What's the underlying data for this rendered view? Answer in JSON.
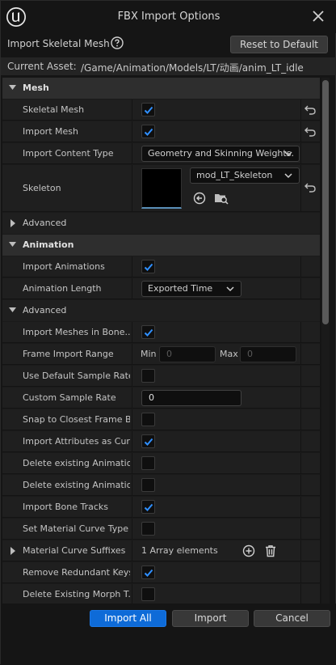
{
  "window": {
    "title": "FBX Import Options"
  },
  "header": {
    "title": "Import Skeletal Mesh",
    "reset_label": "Reset to Default"
  },
  "asset": {
    "label": "Current Asset:",
    "path": "/Game/Animation/Models/LT/动画/anim_LT_idle"
  },
  "mesh_section": {
    "label": "Mesh",
    "skeletal_mesh": {
      "label": "Skeletal Mesh",
      "checked": true
    },
    "import_mesh": {
      "label": "Import Mesh",
      "checked": true
    },
    "import_content_type": {
      "label": "Import Content Type",
      "value": "Geometry and Skinning Weights."
    },
    "skeleton": {
      "label": "Skeleton",
      "value": "mod_LT_Skeleton"
    },
    "advanced_label": "Advanced"
  },
  "animation_section": {
    "label": "Animation",
    "import_animations": {
      "label": "Import Animations",
      "checked": true
    },
    "animation_length": {
      "label": "Animation Length",
      "value": "Exported Time"
    },
    "advanced_label": "Advanced",
    "rows": {
      "import_meshes_in_bone": {
        "label": "Import Meshes in Bone...",
        "checked": true
      },
      "frame_import_range": {
        "label": "Frame Import Range",
        "min_label": "Min",
        "min_value": "0",
        "max_label": "Max",
        "max_value": "0"
      },
      "use_default_sample_rate": {
        "label": "Use Default Sample Rate",
        "checked": false
      },
      "custom_sample_rate": {
        "label": "Custom Sample Rate",
        "value": "0"
      },
      "snap_to_closest_frame": {
        "label": "Snap to Closest Frame B...",
        "checked": false
      },
      "import_attributes_as_curves": {
        "label": "Import Attributes as Cur...",
        "checked": true
      },
      "delete_existing_animation_1": {
        "label": "Delete existing Animatio...",
        "checked": false
      },
      "delete_existing_animation_2": {
        "label": "Delete existing Animatio...",
        "checked": false
      },
      "import_bone_tracks": {
        "label": "Import Bone Tracks",
        "checked": true
      },
      "set_material_curve_type": {
        "label": "Set Material Curve Type",
        "checked": false
      },
      "material_curve_suffixes": {
        "label": "Material Curve Suffixes",
        "value": "1 Array elements"
      },
      "remove_redundant_keys": {
        "label": "Remove Redundant Keys",
        "checked": true
      },
      "delete_existing_morph_target": {
        "label": "Delete Existing Morph T...",
        "checked": false
      }
    }
  },
  "footer": {
    "import_all_label": "Import All",
    "import_label": "Import",
    "cancel_label": "Cancel"
  },
  "colors": {
    "accent": "#0e6bd8",
    "background": "#151515",
    "panel": "#1f1f1f",
    "section": "#2e2e2e"
  }
}
